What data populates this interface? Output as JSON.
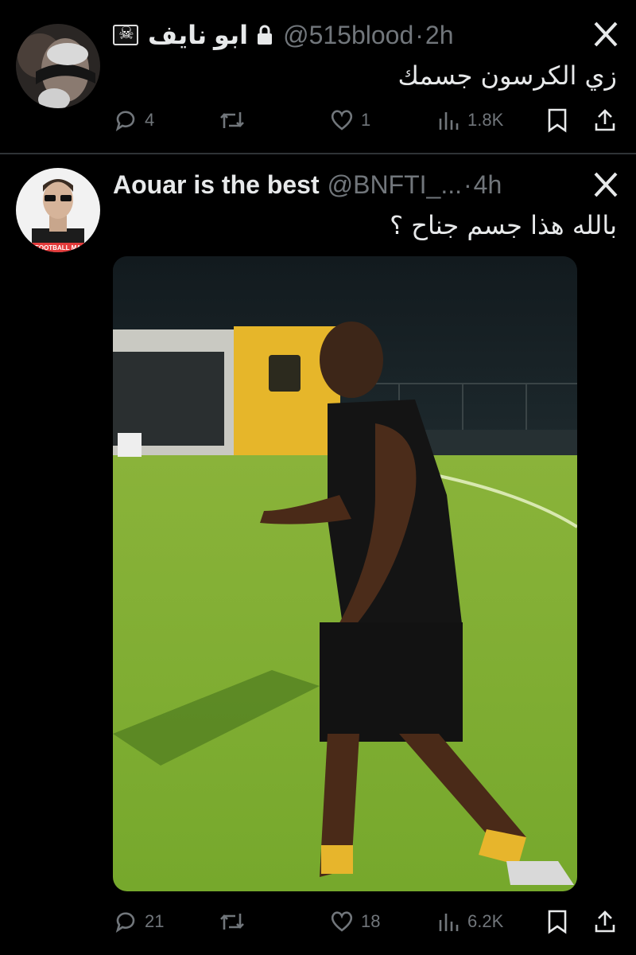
{
  "tweets": [
    {
      "name": "ابو نايف",
      "handle": "@515blood",
      "time": "2h",
      "text": "زي الكرسون جسمك",
      "replies": "4",
      "retweets": "",
      "likes": "1",
      "views": "1.8K"
    },
    {
      "name": "Aouar is the best",
      "handle": "@BNFTI_...",
      "time": "4h",
      "text": "بالله هذا جسم جناح ؟",
      "avatar_caption": "FOOTBALL MA",
      "replies": "21",
      "retweets": "",
      "likes": "18",
      "views": "6.2K"
    }
  ],
  "icons": {
    "close": "x-close-icon",
    "reply": "reply-icon",
    "retweet": "retweet-icon",
    "like": "like-icon",
    "views": "views-icon",
    "bookmark": "bookmark-icon",
    "share": "share-icon",
    "lock": "lock-icon",
    "flag": "pirate-flag-icon"
  },
  "colors": {
    "background": "#000000",
    "text": "#e7e9ea",
    "muted": "#71767b",
    "divider": "#2f3336"
  }
}
